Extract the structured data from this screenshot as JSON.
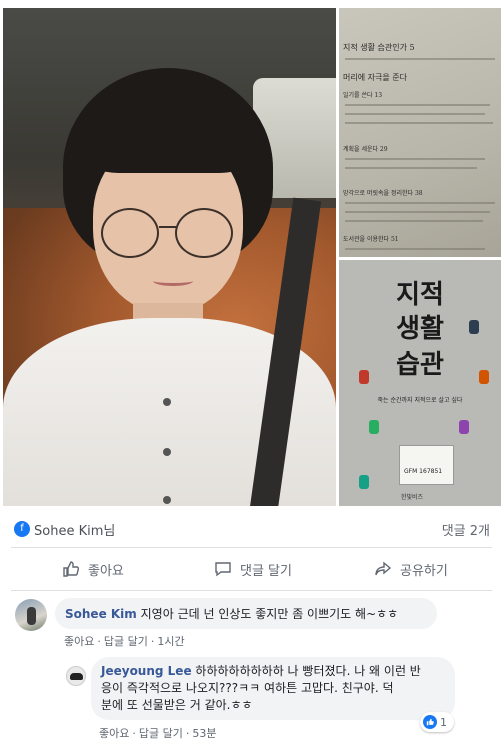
{
  "post": {
    "author_name": "Sohee Kim님",
    "comment_count": "댓글 2개",
    "book_cover": {
      "title_line1": "지적",
      "title_line2": "생활",
      "title_line3": "습관",
      "subtitle": "죽는 순간까지 지적으로 살고 싶다",
      "publisher": "한빛비즈",
      "label_code": "GFM 167851"
    },
    "toc": {
      "lines": [
        "지적 생활 습관인가 5",
        "머리에 자극을 준다",
        "일기를 쓴다 13",
        "계획을 세운다 29",
        "망각으로 머릿속을 정리한다 38",
        "도서관을 이용한다 51"
      ]
    }
  },
  "actions": {
    "like_label": "좋아요",
    "comment_label": "댓글 달기",
    "share_label": "공유하기"
  },
  "comments": [
    {
      "author": "Sohee Kim",
      "text": "지영아 근데 넌 인상도 좋지만 좀 이쁘기도 해~ㅎㅎ",
      "like_label": "좋아요",
      "reply_label": "답글 달기",
      "time": "1시간"
    },
    {
      "author": "Jeeyoung Lee",
      "text_line1": "하하하하하하하하 나 빵터졌다. 나 왜 이런 반",
      "text_line2": "응이 즉각적으로 나오지???ㅋㅋ 여하튼 고맙다. 친구야. 덕",
      "text_line3": "분에 또 선물받은 거 같아.ㅎㅎ",
      "like_label": "좋아요",
      "reply_label": "답글 달기",
      "time": "53분",
      "reaction_count": "1"
    }
  ]
}
